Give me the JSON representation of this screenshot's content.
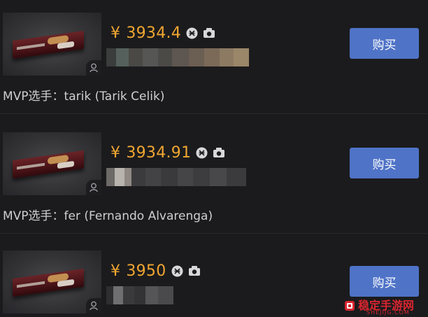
{
  "listings": [
    {
      "currency": "¥",
      "price": "3934.4",
      "mvp_text": "MVP选手：tarik (Tarik Celik)",
      "buy_label": "购买",
      "icons": [
        "wear-badge-icon",
        "sticker-icon",
        "player-icon"
      ]
    },
    {
      "currency": "¥",
      "price": "3934.91",
      "mvp_text": "MVP选手：fer (Fernando Alvarenga)",
      "buy_label": "购买",
      "icons": [
        "wear-badge-icon",
        "sticker-icon",
        "player-icon"
      ]
    },
    {
      "currency": "¥",
      "price": "3950",
      "mvp_text": "",
      "buy_label": "购买",
      "icons": [
        "wear-badge-icon",
        "sticker-icon",
        "player-icon"
      ]
    }
  ],
  "watermark": {
    "name": "稳定手游网",
    "domain": "SHEJIJG.COM"
  },
  "colors": {
    "background": "#1b1b1d",
    "price": "#f0a631",
    "button": "#4f73c7",
    "text": "#cfcfd2",
    "watermark": "#d9252f"
  }
}
